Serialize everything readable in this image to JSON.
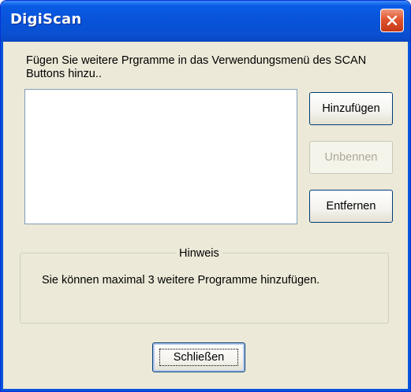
{
  "window": {
    "title": "DigiScan"
  },
  "content": {
    "instruction": "Fügen Sie weitere Prgramme in das Verwendungsmenü des SCAN Buttons hinzu..",
    "program_list": []
  },
  "buttons": {
    "add_label": "Hinzufügen",
    "rename_label": "Unbennen",
    "remove_label": "Entfernen",
    "close_label": "Schließen"
  },
  "hint": {
    "title": "Hinweis",
    "text": "Sie können maximal 3 weitere Programme hinzufügen."
  },
  "icons": {
    "close": "close-icon"
  },
  "colors": {
    "titlebar": "#0a5be5",
    "close_button": "#e1552d",
    "dialog_bg": "#ece9d8",
    "disabled_text": "#aca899"
  }
}
